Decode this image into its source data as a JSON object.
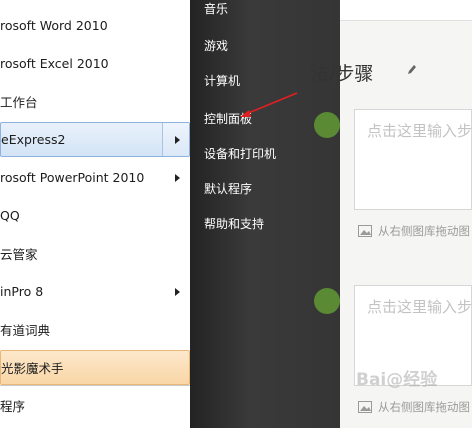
{
  "start_menu": {
    "programs": [
      {
        "label": "rosoft Word 2010",
        "has_submenu": false,
        "state": "normal"
      },
      {
        "label": "rosoft Excel 2010",
        "has_submenu": false,
        "state": "normal"
      },
      {
        "label": "工作台",
        "has_submenu": false,
        "state": "normal"
      },
      {
        "label": "eExpress2",
        "has_submenu": true,
        "state": "selected"
      },
      {
        "label": "rosoft PowerPoint 2010",
        "has_submenu": true,
        "state": "normal"
      },
      {
        "label": "QQ",
        "has_submenu": false,
        "state": "normal"
      },
      {
        "label": "云管家",
        "has_submenu": false,
        "state": "normal"
      },
      {
        "label": "inPro 8",
        "has_submenu": true,
        "state": "normal"
      },
      {
        "label": "有道词典",
        "has_submenu": false,
        "state": "normal"
      },
      {
        "label": "光影魔术手",
        "has_submenu": false,
        "state": "highlight"
      },
      {
        "label": "程序",
        "has_submenu": false,
        "state": "normal"
      }
    ],
    "right_items": [
      "音乐",
      "游戏",
      "计算机",
      "控制面板",
      "设备和打印机",
      "默认程序",
      "帮助和支持"
    ]
  },
  "editor": {
    "section_title": "法/步骤",
    "input_placeholder": "点击这里输入步",
    "drag_hint": "从右侧图库拖动图",
    "watermark": "Bai@经验"
  },
  "colors": {
    "step_circle": "#5a8a33",
    "annotation_arrow": "#e02020",
    "selected_item": "#d3e4f6",
    "highlight_item": "#f9d6a6"
  }
}
